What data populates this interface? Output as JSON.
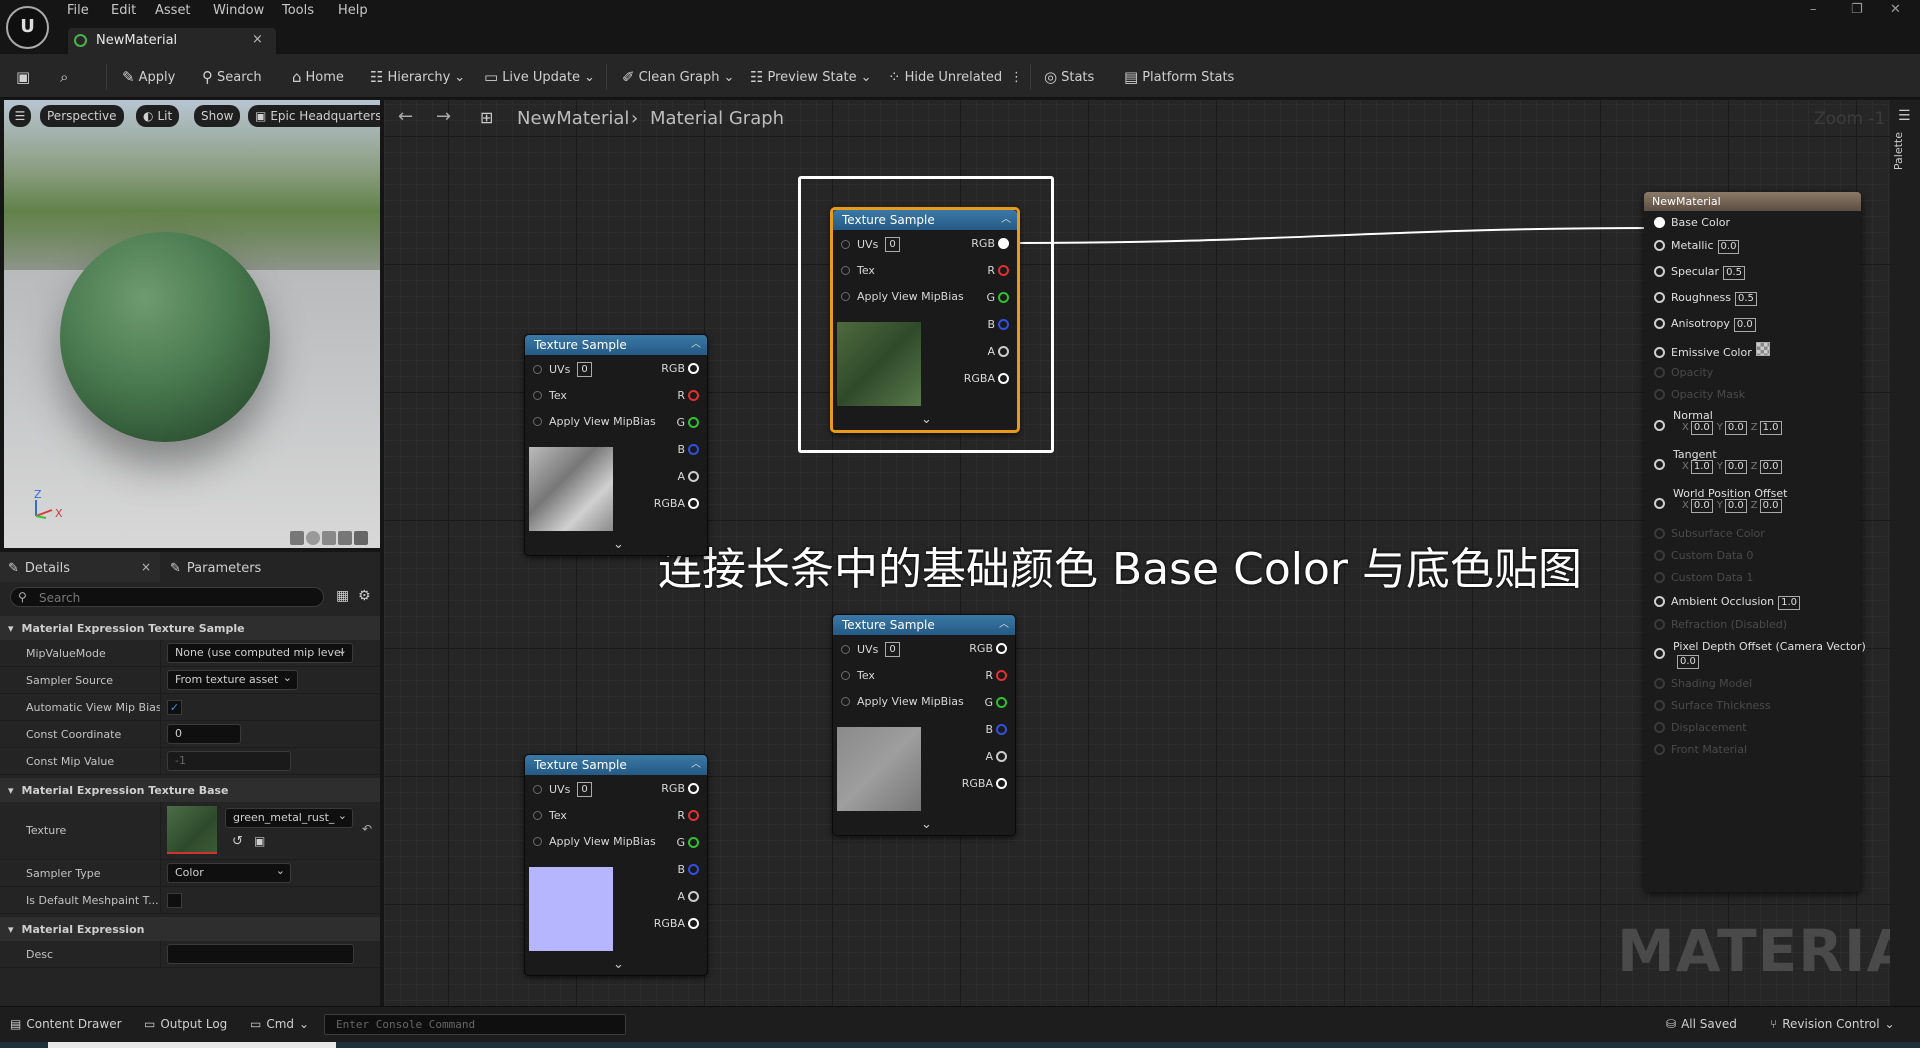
{
  "menu": [
    "File",
    "Edit",
    "Asset",
    "Window",
    "Tools",
    "Help"
  ],
  "doc_tab": {
    "title": "NewMaterial",
    "close": "×"
  },
  "window_controls": [
    "–",
    "❐",
    "✕"
  ],
  "toolbar": {
    "apply": "Apply",
    "search": "Search",
    "home": "Home",
    "hierarchy": "Hierarchy",
    "live_update": "Live Update",
    "clean_graph": "Clean Graph",
    "preview_state": "Preview State",
    "hide_unrelated": "Hide Unrelated",
    "stats": "Stats",
    "platform_stats": "Platform Stats"
  },
  "viewport": {
    "perspective": "Perspective",
    "lit": "Lit",
    "show": "Show",
    "env": "Epic Headquarters",
    "axis_z": "Z",
    "axis_x": "X"
  },
  "details": {
    "tab_details": "Details",
    "tab_close": "×",
    "tab_parameters": "Parameters",
    "search_placeholder": "Search",
    "sec1": "Material Expression Texture Sample",
    "mip_value_mode_label": "MipValueMode",
    "mip_value_mode": "None (use computed mip level",
    "sampler_source_label": "Sampler Source",
    "sampler_source": "From texture asset",
    "auto_mip_label": "Automatic View Mip Bias",
    "auto_mip": "✓",
    "const_coord_label": "Const Coordinate",
    "const_coord": "0",
    "const_mip_label": "Const Mip Value",
    "const_mip": "-1",
    "sec2": "Material Expression Texture Base",
    "texture_label": "Texture",
    "texture_value": "green_metal_rust_",
    "sampler_type_label": "Sampler Type",
    "sampler_type": "Color",
    "default_meshpaint_label": "Is Default Meshpaint T...",
    "sec3": "Material Expression",
    "desc_label": "Desc",
    "desc_value": ""
  },
  "graph": {
    "breadcrumb_root": "NewMaterial",
    "breadcrumb_sep": "›",
    "breadcrumb_page": "Material Graph",
    "zoom": "Zoom -1",
    "palette": "Palette"
  },
  "texture_node": {
    "title": "Texture Sample",
    "uvs": "UVs",
    "uv_value": "0",
    "tex": "Tex",
    "mipbias": "Apply View MipBias",
    "outputs": [
      "RGB",
      "R",
      "G",
      "B",
      "A",
      "RGBA"
    ]
  },
  "material_node": {
    "title": "NewMaterial",
    "base_color": "Base Color",
    "metallic": "Metallic",
    "metallic_v": "0.0",
    "specular": "Specular",
    "specular_v": "0.5",
    "roughness": "Roughness",
    "roughness_v": "0.5",
    "anisotropy": "Anisotropy",
    "anisotropy_v": "0.0",
    "emissive": "Emissive Color",
    "opacity": "Opacity",
    "opacity_mask": "Opacity Mask",
    "normal": "Normal",
    "normal_x": "0.0",
    "normal_y": "0.0",
    "normal_z": "1.0",
    "tangent": "Tangent",
    "tangent_x": "1.0",
    "tangent_y": "0.0",
    "tangent_z": "0.0",
    "wpo": "World Position Offset",
    "wpo_x": "0.0",
    "wpo_y": "0.0",
    "wpo_z": "0.0",
    "subsurface": "Subsurface Color",
    "custom0": "Custom Data 0",
    "custom1": "Custom Data 1",
    "ao": "Ambient Occlusion",
    "ao_v": "1.0",
    "refraction": "Refraction (Disabled)",
    "pdo": "Pixel Depth Offset (Camera Vector)",
    "pdo_v": "0.0",
    "shading_model": "Shading Model",
    "surface_thickness": "Surface Thickness",
    "displacement": "Displacement",
    "front_material": "Front Material",
    "axis_x": "X",
    "axis_y": "Y",
    "axis_z": "Z"
  },
  "subtitle": "连接长条中的基础颜色 Base Color 与底色贴图",
  "watermark": "MATERIAL",
  "status": {
    "content_drawer": "Content Drawer",
    "output_log": "Output Log",
    "cmd": "Cmd",
    "console_placeholder": "Enter Console Command",
    "all_saved": "All Saved",
    "revision_control": "Revision Control"
  },
  "colors": {
    "pin_r": "#e03030",
    "pin_g": "#30c030",
    "pin_b": "#3050e0",
    "node_head": "#2f6b97",
    "mat_head": "#7a6a5c",
    "selection": "#e89a1a"
  }
}
